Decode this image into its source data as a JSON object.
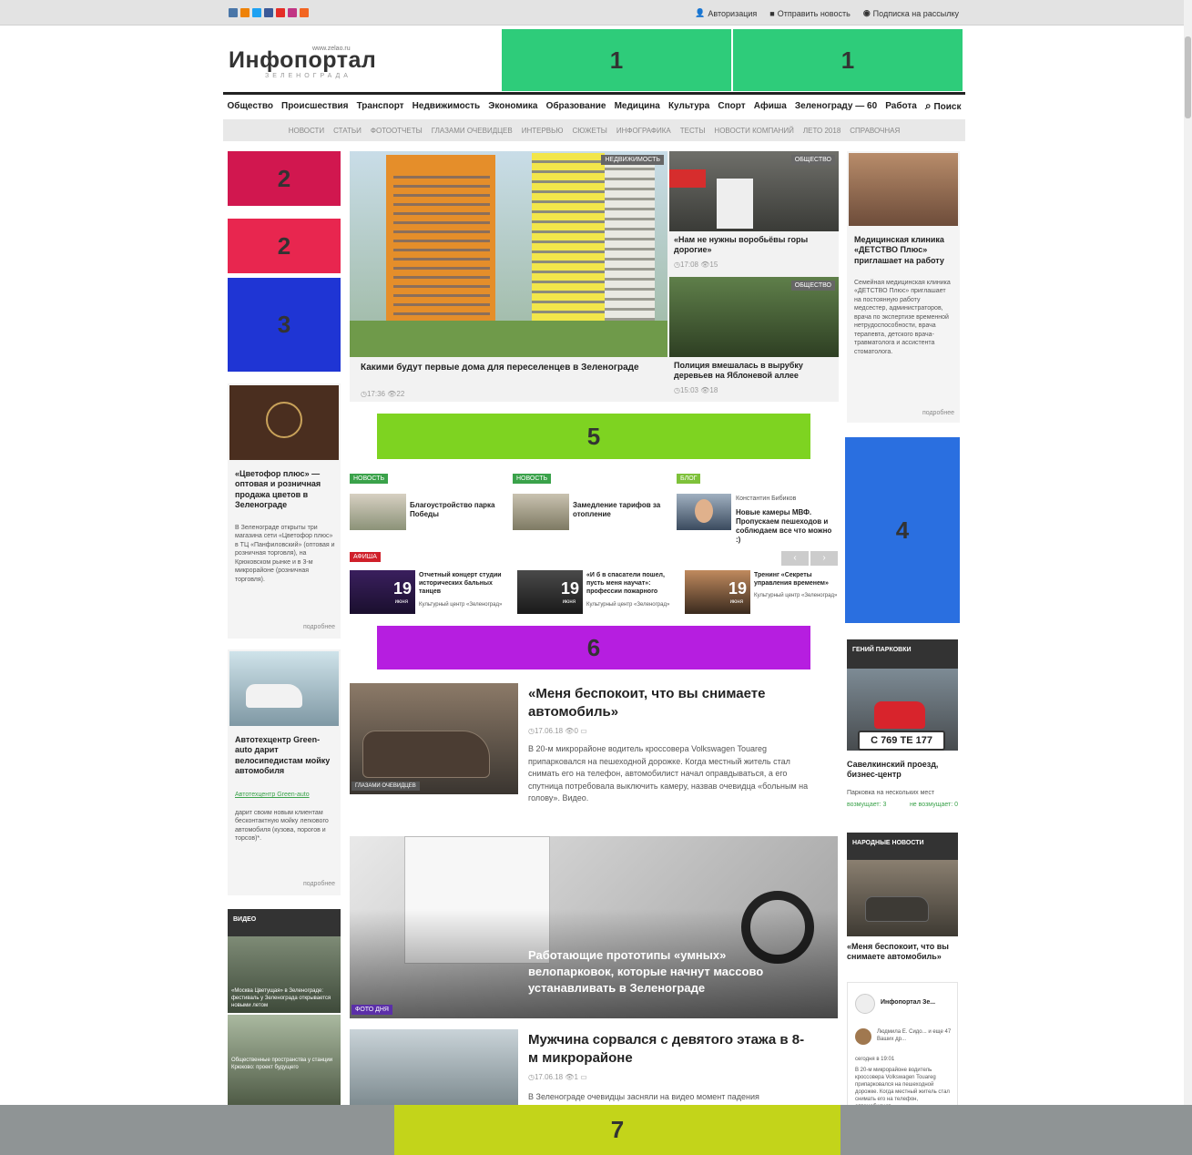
{
  "topbar": {
    "social_icons": [
      "vk-icon",
      "odnoklassniki-icon",
      "twitter-icon",
      "facebook-icon",
      "youtube-icon",
      "instagram-icon",
      "rss-icon"
    ],
    "links": [
      {
        "icon": "user-icon",
        "label": "Авторизация"
      },
      {
        "icon": "comment-icon",
        "label": "Отправить новость"
      },
      {
        "icon": "mail-icon",
        "label": "Подписка на рассылку"
      }
    ]
  },
  "logo": {
    "text": "Инфопортал",
    "url": "www.zelao.ru",
    "subtitle": "ЗЕЛЕНОГРАДА"
  },
  "ads": {
    "top_left": "1",
    "top_right": "1",
    "left_a": "2",
    "left_b": "2",
    "left_c": "3",
    "right": "4",
    "mid_a": "5",
    "mid_b": "6",
    "bottom": "7"
  },
  "main_nav": [
    "Общество",
    "Происшествия",
    "Транспорт",
    "Недвижимость",
    "Экономика",
    "Образование",
    "Медицина",
    "Культура",
    "Спорт",
    "Афиша",
    "Зеленограду — 60",
    "Работа",
    "Поиск"
  ],
  "sub_nav": [
    "НОВОСТИ",
    "СТАТЬИ",
    "ФОТООТЧЕТЫ",
    "ГЛАЗАМИ ОЧЕВИДЦЕВ",
    "ИНТЕРВЬЮ",
    "СЮЖЕТЫ",
    "ИНФОГРАФИКА",
    "ТЕСТЫ",
    "НОВОСТИ КОМПАНИЙ",
    "ЛЕТО 2018",
    "СПРАВОЧНАЯ"
  ],
  "hero": {
    "big": {
      "badge": "НЕДВИЖИМОСТЬ",
      "title": "Какими будут первые дома для переселенцев в Зеленограде",
      "time": "17:36",
      "views": "22"
    },
    "top_right": {
      "badge": "ОБЩЕСТВО",
      "title": "«Нам не нужны воробьёвы горы дорогие»",
      "time": "17:08",
      "views": "15"
    },
    "bottom_right": {
      "badge": "ОБЩЕСТВО",
      "title": "Полиция вмешалась в вырубку деревьев на Яблоневой аллее",
      "time": "15:03",
      "views": "18"
    }
  },
  "left_sidebar": {
    "promo1": {
      "title": "«Цветофор плюс» — оптовая и розничная продажа цветов в Зеленограде",
      "text": "В Зеленограде открыты три магазина сети «Цветофор плюс» в ТЦ «Панфиловский» (оптовая и розничная торговля), на Крюковском рынке и в 3-м микрорайоне (розничная торговля).",
      "link": "«Цветофор плюс»",
      "more": "подробнее"
    },
    "promo2": {
      "title": "Автотехцентр Green-auto дарит велосипедистам мойку автомобиля",
      "link": "Автотехцентр Green-auto",
      "text": "дарит своим новым клиентам бесконтактную мойку легкового автомобиля (кузова, порогов и торсов)*.",
      "more": "подробнее"
    },
    "video": {
      "header": "ВИДЕО",
      "item1": "«Москва Цветущая» в Зеленограде: фестиваль у Зеленограда открывается новыми летом",
      "item2": "Общественные пространства у станции Крюково: проект будущего"
    }
  },
  "right_sidebar": {
    "promo": {
      "title": "Медицинская клиника «ДЕТСТВО Плюс» приглашает на работу",
      "text": "Семейная медицинская клиника «ДЕТСТВО Плюс» приглашает на постоянную работу медсестер, администраторов, врача по экспертизе временной нетрудоспособности, врача терапевта, детского врача-травматолога и ассистента стоматолога.",
      "link": "приглашает на постоянную работу",
      "more": "подробнее"
    },
    "parking": {
      "header": "ГЕНИЙ ПАРКОВКИ",
      "plate": "С 769 ТЕ 177",
      "title": "Савелкинский проезд, бизнес-центр",
      "text": "Парковка на нескольких мест",
      "yes": "возмущает: 3",
      "no": "не возмущает: 0"
    },
    "people": {
      "header": "НАРОДНЫЕ НОВОСТИ",
      "title": "«Меня беспокоит, что вы снимаете автомобиль»"
    },
    "vk": {
      "group": "Инфопортал Зе...",
      "user": "Людмила Е. Сидо... и еще 47 Ваших др...",
      "date": "сегодня в 19:01",
      "text": "В 20-м микрорайоне водитель кроссовера Volkswagen Touareg припарковался на пешеходной дорожке. Когда местный житель стал снимать его на телефон, автомобилист..."
    }
  },
  "news_row": [
    {
      "badge": "НОВОСТЬ",
      "title": "Благоустройство парка Победы"
    },
    {
      "badge": "НОВОСТЬ",
      "title": "Замедление тарифов за отопление"
    },
    {
      "badge": "БЛОГ",
      "author": "Константин Бибиков",
      "title": "Новые камеры МВФ. Пропускаем пешеходов и соблюдаем все что можно :)"
    }
  ],
  "afisha": {
    "badge": "АФИША",
    "events": [
      {
        "day": "19",
        "month": "июня",
        "title": "Отчетный концерт студии исторических бальных танцев",
        "venue": "Культурный центр «Зеленоград»"
      },
      {
        "day": "19",
        "month": "июня",
        "title": "«И б в спасатели пошел, пусть меня научат»: профессии пожарного",
        "venue": "Культурный центр «Зеленоград»"
      },
      {
        "day": "19",
        "month": "июня",
        "title": "Тренинг «Секреты управления временем»",
        "venue": "Культурный центр «Зеленоград»"
      }
    ]
  },
  "articles": [
    {
      "title": "«Меня беспокоит, что вы снимаете автомобиль»",
      "date": "17.06.18",
      "views": "0",
      "badge": "ГЛАЗАМИ ОЧЕВИДЦЕВ",
      "text": "В 20-м микрорайоне водитель кроссовера Volkswagen Touareg припарковался на пешеходной дорожке. Когда местный житель стал снимать его на телефон, автомобилист начал оправдываться, а его спутница потребовала выключить камеру, назвав очевидца «больным на голову». Видео."
    },
    {
      "title": "Работающие прототипы «умных» велопарковок, которые начнут массово устанавливать в Зеленограде",
      "badge": "ФОТО ДНЯ"
    },
    {
      "title": "Мужчина сорвался с девятого этажа в 8-м микрорайоне",
      "date": "17.06.18",
      "views": "1",
      "text": "В Зеленограде очевидцы засняли на видео момент падения"
    }
  ],
  "colors": {
    "ad1": "#2ecc7a",
    "ad2a": "#d1174f",
    "ad2b": "#e8264f",
    "ad3": "#1f35d4",
    "ad4": "#2a6fe0",
    "ad5": "#7ed321",
    "ad6": "#b61ee0",
    "ad7": "#c3d41a"
  }
}
